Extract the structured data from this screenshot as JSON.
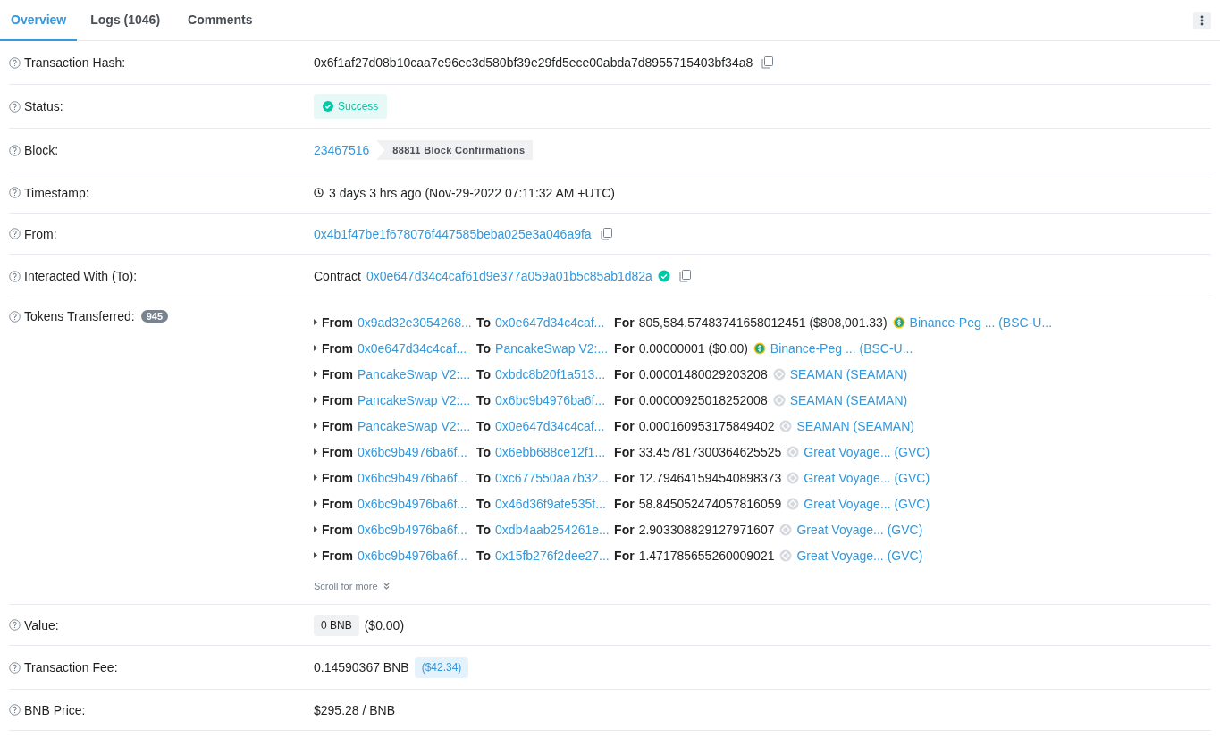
{
  "tabs": [
    {
      "label": "Overview",
      "selected": true
    },
    {
      "label": "Logs (1046)",
      "selected": false
    },
    {
      "label": "Comments",
      "selected": false
    }
  ],
  "details": [
    {
      "kind": "hash",
      "label": "Transaction Hash:",
      "value": "0x6f1af27d08b10caa7e96ec3d580bf39e29fd5ece00abda7d8955715403bf34a8"
    },
    {
      "kind": "status",
      "label": "Status:",
      "value": "Success"
    },
    {
      "kind": "block",
      "label": "Block:",
      "value": "23467516",
      "badge": "88811 Block Confirmations"
    },
    {
      "kind": "timestamp",
      "label": "Timestamp:",
      "value": "3 days 3 hrs ago (Nov-29-2022 07:11:32 AM +UTC)"
    },
    {
      "kind": "address",
      "label": "From:",
      "value": "0x4b1f47be1f678076f447585beba025e3a046a9fa"
    },
    {
      "kind": "contract",
      "label": "Interacted With (To):",
      "prefix": "Contract",
      "value": "0x0e647d34c4caf61d9e377a059a01b5c85ab1d82a"
    },
    {
      "kind": "tokens",
      "label": "Tokens Transferred:",
      "count": "945",
      "more": "Scroll for more",
      "transfers": [
        {
          "from_label": "From",
          "from": "0x9ad32e3054268...",
          "to_label": "To",
          "to": "0x0e647d34c4caf...",
          "for_label": "For",
          "amount": "805,584.57483741658012451 ($808,001.33)",
          "kind": "dollar",
          "token": "Binance-Peg ... (BSC-U..."
        },
        {
          "from_label": "From",
          "from": "0x0e647d34c4caf...",
          "to_label": "To",
          "to": "PancakeSwap V2:...",
          "for_label": "For",
          "amount": "0.00000001 ($0.00)",
          "kind": "dollar",
          "token": "Binance-Peg ... (BSC-U..."
        },
        {
          "from_label": "From",
          "from": "PancakeSwap V2:...",
          "to_label": "To",
          "to": "0xbdc8b20f1a513...",
          "for_label": "For",
          "amount": "0.00001480029203208",
          "kind": "generic",
          "token": "SEAMAN (SEAMAN)"
        },
        {
          "from_label": "From",
          "from": "PancakeSwap V2:...",
          "to_label": "To",
          "to": "0x6bc9b4976ba6f...",
          "for_label": "For",
          "amount": "0.00000925018252008",
          "kind": "generic",
          "token": "SEAMAN (SEAMAN)"
        },
        {
          "from_label": "From",
          "from": "PancakeSwap V2:...",
          "to_label": "To",
          "to": "0x0e647d34c4caf...",
          "for_label": "For",
          "amount": "0.000160953175849402",
          "kind": "generic",
          "token": "SEAMAN (SEAMAN)"
        },
        {
          "from_label": "From",
          "from": "0x6bc9b4976ba6f...",
          "to_label": "To",
          "to": "0x6ebb688ce12f1...",
          "for_label": "For",
          "amount": "33.457817300364625525",
          "kind": "generic",
          "token": "Great Voyage... (GVC)"
        },
        {
          "from_label": "From",
          "from": "0x6bc9b4976ba6f...",
          "to_label": "To",
          "to": "0xc677550aa7b32...",
          "for_label": "For",
          "amount": "12.794641594540898373",
          "kind": "generic",
          "token": "Great Voyage... (GVC)"
        },
        {
          "from_label": "From",
          "from": "0x6bc9b4976ba6f...",
          "to_label": "To",
          "to": "0x46d36f9afe535f...",
          "for_label": "For",
          "amount": "58.845052474057816059",
          "kind": "generic",
          "token": "Great Voyage... (GVC)"
        },
        {
          "from_label": "From",
          "from": "0x6bc9b4976ba6f...",
          "to_label": "To",
          "to": "0xdb4aab254261e...",
          "for_label": "For",
          "amount": "2.903308829127971607",
          "kind": "generic",
          "token": "Great Voyage... (GVC)"
        },
        {
          "from_label": "From",
          "from": "0x6bc9b4976ba6f...",
          "to_label": "To",
          "to": "0x15fb276f2dee27...",
          "for_label": "For",
          "amount": "1.471785655260009021",
          "kind": "generic",
          "token": "Great Voyage... (GVC)"
        }
      ]
    },
    {
      "kind": "value",
      "label": "Value:",
      "value": "0 BNB",
      "extra": "($0.00)"
    },
    {
      "kind": "fee",
      "label": "Transaction Fee:",
      "value": "0.14590367 BNB",
      "extra": "($42.34)"
    },
    {
      "kind": "plain",
      "label": "BNB Price:",
      "value": "$295.28 / BNB"
    }
  ]
}
